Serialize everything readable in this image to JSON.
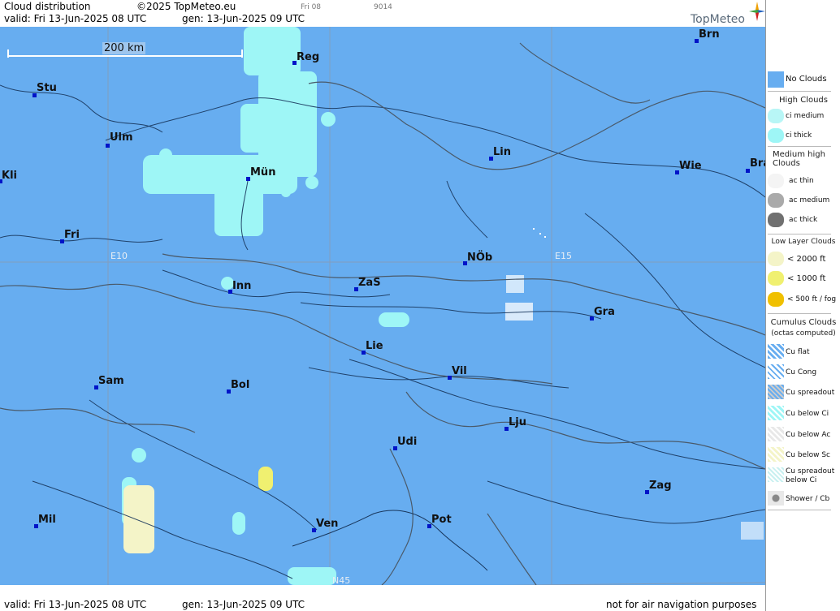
{
  "header": {
    "title": "Cloud distribution",
    "copyright": "©2025 TopMeteo.eu",
    "run": "Fri 08",
    "code": "9014",
    "valid": "valid:  Fri  13-Jun-2025  08 UTC",
    "gen": "gen: 13-Jun-2025 09 UTC",
    "brand": "TopMeteo"
  },
  "scale": {
    "label": "200 km"
  },
  "cities": [
    {
      "name": "Reg"
    },
    {
      "name": "Brn"
    },
    {
      "name": "Stu"
    },
    {
      "name": "Ulm"
    },
    {
      "name": "Lin"
    },
    {
      "name": "Kli"
    },
    {
      "name": "Mün"
    },
    {
      "name": "Wie"
    },
    {
      "name": "Bra"
    },
    {
      "name": "Fri"
    },
    {
      "name": "NÖb"
    },
    {
      "name": "Inn"
    },
    {
      "name": "ZaS"
    },
    {
      "name": "Gra"
    },
    {
      "name": "Lie"
    },
    {
      "name": "Sam"
    },
    {
      "name": "Vil"
    },
    {
      "name": "Bol"
    },
    {
      "name": "Lju"
    },
    {
      "name": "Udi"
    },
    {
      "name": "Zag"
    },
    {
      "name": "Mil"
    },
    {
      "name": "Ven"
    },
    {
      "name": "Pot"
    }
  ],
  "grid_labels": {
    "e10": "E10",
    "e15": "E15",
    "n45": "N45"
  },
  "footer": {
    "valid": "valid:  Fri  13-Jun-2025  08 UTC",
    "gen": "gen: 13-Jun-2025 09 UTC",
    "disclaimer": "not for air navigation purposes"
  },
  "legend": {
    "no_clouds": "No Clouds",
    "high_title": "High Clouds",
    "ci_medium": "ci medium",
    "ci_thick": "ci thick",
    "medium_title": "Medium high Clouds",
    "ac_thin": "ac thin",
    "ac_medium": "ac medium",
    "ac_thick": "ac thick",
    "low_title": "Low Layer Clouds",
    "low_2000": "< 2000 ft",
    "low_1000": "< 1000 ft",
    "low_500": "< 500 ft / fog",
    "cu_title": "Cumulus Clouds",
    "cu_sub": "(octas computed)",
    "cu_flat": "Cu flat",
    "cu_cong": "Cu Cong",
    "cu_spread": "Cu spreadout",
    "cu_below_ci": "Cu below Ci",
    "cu_below_ac": "Cu below Ac",
    "cu_below_sc": "Cu below Sc",
    "cu_spread_below_ci": "Cu spreadout below Ci",
    "shower": "Shower / Cb"
  },
  "colors": {
    "no_clouds": "#67adf0",
    "ci": "#9ef6f6",
    "low_2000": "#f4f4c8",
    "low_1000": "#f0f070",
    "low_500": "#f0c000",
    "city_marker": "#0014c8"
  }
}
